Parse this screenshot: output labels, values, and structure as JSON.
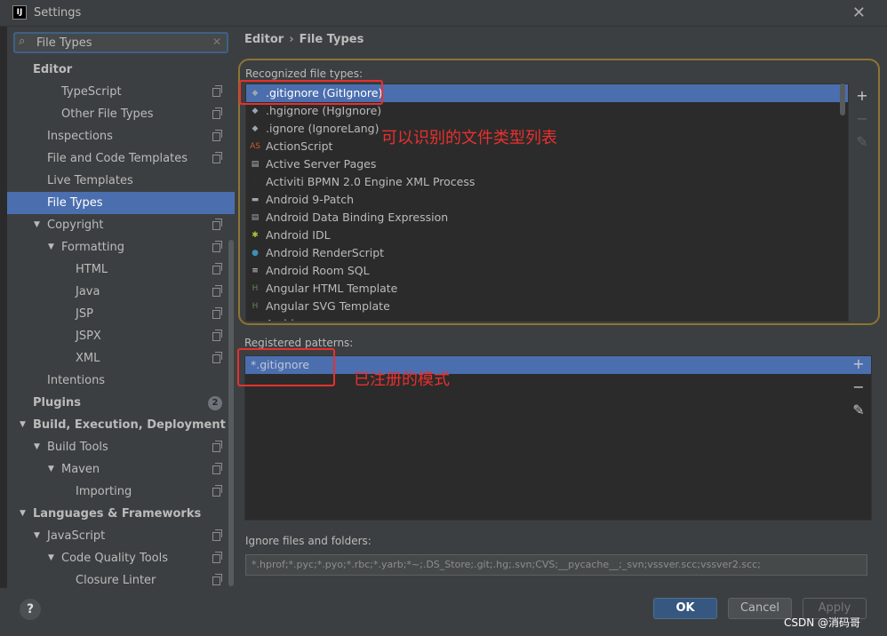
{
  "window": {
    "title": "Settings",
    "app_icon": "IJ",
    "close": "✕"
  },
  "search": {
    "value": "File Types",
    "icon": "⌕",
    "clear": "✕"
  },
  "tree": [
    {
      "label": "Editor",
      "bold": true,
      "arrow": "",
      "indent": 0,
      "copy": false,
      "selected": false
    },
    {
      "label": "TypeScript",
      "bold": false,
      "arrow": "",
      "indent": 2,
      "copy": true,
      "selected": false
    },
    {
      "label": "Other File Types",
      "bold": false,
      "arrow": "",
      "indent": 2,
      "copy": true,
      "selected": false
    },
    {
      "label": "Inspections",
      "bold": false,
      "arrow": "",
      "indent": 1,
      "copy": true,
      "selected": false
    },
    {
      "label": "File and Code Templates",
      "bold": false,
      "arrow": "",
      "indent": 1,
      "copy": true,
      "selected": false
    },
    {
      "label": "Live Templates",
      "bold": false,
      "arrow": "",
      "indent": 1,
      "copy": false,
      "selected": false
    },
    {
      "label": "File Types",
      "bold": false,
      "arrow": "",
      "indent": 1,
      "copy": false,
      "selected": true
    },
    {
      "label": "Copyright",
      "bold": false,
      "arrow": "▼",
      "indent": 1,
      "copy": true,
      "selected": false
    },
    {
      "label": "Formatting",
      "bold": false,
      "arrow": "▼",
      "indent": 2,
      "copy": true,
      "selected": false
    },
    {
      "label": "HTML",
      "bold": false,
      "arrow": "",
      "indent": 3,
      "copy": true,
      "selected": false
    },
    {
      "label": "Java",
      "bold": false,
      "arrow": "",
      "indent": 3,
      "copy": true,
      "selected": false
    },
    {
      "label": "JSP",
      "bold": false,
      "arrow": "",
      "indent": 3,
      "copy": true,
      "selected": false
    },
    {
      "label": "JSPX",
      "bold": false,
      "arrow": "",
      "indent": 3,
      "copy": true,
      "selected": false
    },
    {
      "label": "XML",
      "bold": false,
      "arrow": "",
      "indent": 3,
      "copy": true,
      "selected": false
    },
    {
      "label": "Intentions",
      "bold": false,
      "arrow": "",
      "indent": 1,
      "copy": false,
      "selected": false
    },
    {
      "label": "Plugins",
      "bold": true,
      "arrow": "",
      "indent": 0,
      "copy": false,
      "selected": false,
      "badge": "2"
    },
    {
      "label": "Build, Execution, Deployment",
      "bold": true,
      "arrow": "▼",
      "indent": 0,
      "copy": false,
      "selected": false
    },
    {
      "label": "Build Tools",
      "bold": false,
      "arrow": "▼",
      "indent": 1,
      "copy": true,
      "selected": false
    },
    {
      "label": "Maven",
      "bold": false,
      "arrow": "▼",
      "indent": 2,
      "copy": true,
      "selected": false
    },
    {
      "label": "Importing",
      "bold": false,
      "arrow": "",
      "indent": 3,
      "copy": true,
      "selected": false
    },
    {
      "label": "Languages & Frameworks",
      "bold": true,
      "arrow": "▼",
      "indent": 0,
      "copy": false,
      "selected": false
    },
    {
      "label": "JavaScript",
      "bold": false,
      "arrow": "▼",
      "indent": 1,
      "copy": true,
      "selected": false
    },
    {
      "label": "Code Quality Tools",
      "bold": false,
      "arrow": "▼",
      "indent": 2,
      "copy": true,
      "selected": false
    },
    {
      "label": "Closure Linter",
      "bold": false,
      "arrow": "",
      "indent": 3,
      "copy": true,
      "selected": false
    }
  ],
  "breadcrumb": {
    "parent": "Editor",
    "separator": "›",
    "current": "File Types"
  },
  "recognized": {
    "label": "Recognized file types:",
    "items": [
      {
        "name": ".gitignore (GitIgnore)",
        "icon": "git-file-icon",
        "icon_color": "#9aa7b0",
        "glyph": "◆",
        "selected": true
      },
      {
        "name": ".hgignore (HgIgnore)",
        "icon": "hg-file-icon",
        "icon_color": "#9aa7b0",
        "glyph": "◆",
        "selected": false
      },
      {
        "name": ".ignore (IgnoreLang)",
        "icon": "ignore-file-icon",
        "icon_color": "#9aa7b0",
        "glyph": "◆",
        "selected": false
      },
      {
        "name": "ActionScript",
        "icon": "actionscript-icon",
        "icon_color": "#cc5a2c",
        "glyph": "AS",
        "selected": false
      },
      {
        "name": "Active Server Pages",
        "icon": "asp-file-icon",
        "icon_color": "#aeb9c0",
        "glyph": "▤",
        "selected": false
      },
      {
        "name": "Activiti BPMN 2.0 Engine XML Process",
        "icon": "bpmn-icon",
        "icon_color": "#3c3f41",
        "glyph": "·",
        "selected": false
      },
      {
        "name": "Android 9-Patch",
        "icon": "folder-icon",
        "icon_color": "#9aa7b0",
        "glyph": "▬",
        "selected": false
      },
      {
        "name": "Android Data Binding Expression",
        "icon": "data-binding-icon",
        "icon_color": "#9aa7b0",
        "glyph": "▤",
        "selected": false
      },
      {
        "name": "Android IDL",
        "icon": "android-icon",
        "icon_color": "#a4c639",
        "glyph": "✱",
        "selected": false
      },
      {
        "name": "Android RenderScript",
        "icon": "renderscript-icon",
        "icon_color": "#3d8fb5",
        "glyph": "●",
        "selected": false
      },
      {
        "name": "Android Room SQL",
        "icon": "room-sql-icon",
        "icon_color": "#d8d8d8",
        "glyph": "≡",
        "selected": false
      },
      {
        "name": "Angular HTML Template",
        "icon": "angular-html-icon",
        "icon_color": "#5c8a5a",
        "glyph": "H",
        "selected": false
      },
      {
        "name": "Angular SVG Template",
        "icon": "angular-svg-icon",
        "icon_color": "#5c8a5a",
        "glyph": "H",
        "selected": false
      },
      {
        "name": "Archive",
        "icon": "archive-icon",
        "icon_color": "#9aa7b0",
        "glyph": "▤",
        "selected": false
      }
    ]
  },
  "patterns": {
    "label": "Registered patterns:",
    "items": [
      {
        "value": "*.gitignore",
        "selected": true
      }
    ]
  },
  "toolbar": {
    "add": "+",
    "remove": "−",
    "edit": "✎"
  },
  "ignore": {
    "label": "Ignore files and folders:",
    "value": "*.hprof;*.pyc;*.pyo;*.rbc;*.yarb;*~;.DS_Store;.git;.hg;.svn;CVS;__pycache__;_svn;vssver.scc;vssver2.scc;"
  },
  "annotations": {
    "file_types": "可以识别的文件类型列表",
    "patterns": "已注册的模式"
  },
  "buttons": {
    "help": "?",
    "ok": "OK",
    "cancel": "Cancel",
    "apply": "Apply"
  },
  "watermark": "CSDN @消码哥",
  "colors": {
    "selection": "#4b6eaf",
    "highlight": "#e8302e",
    "accent_border": "#8d7432",
    "ok_button": "#365880"
  }
}
